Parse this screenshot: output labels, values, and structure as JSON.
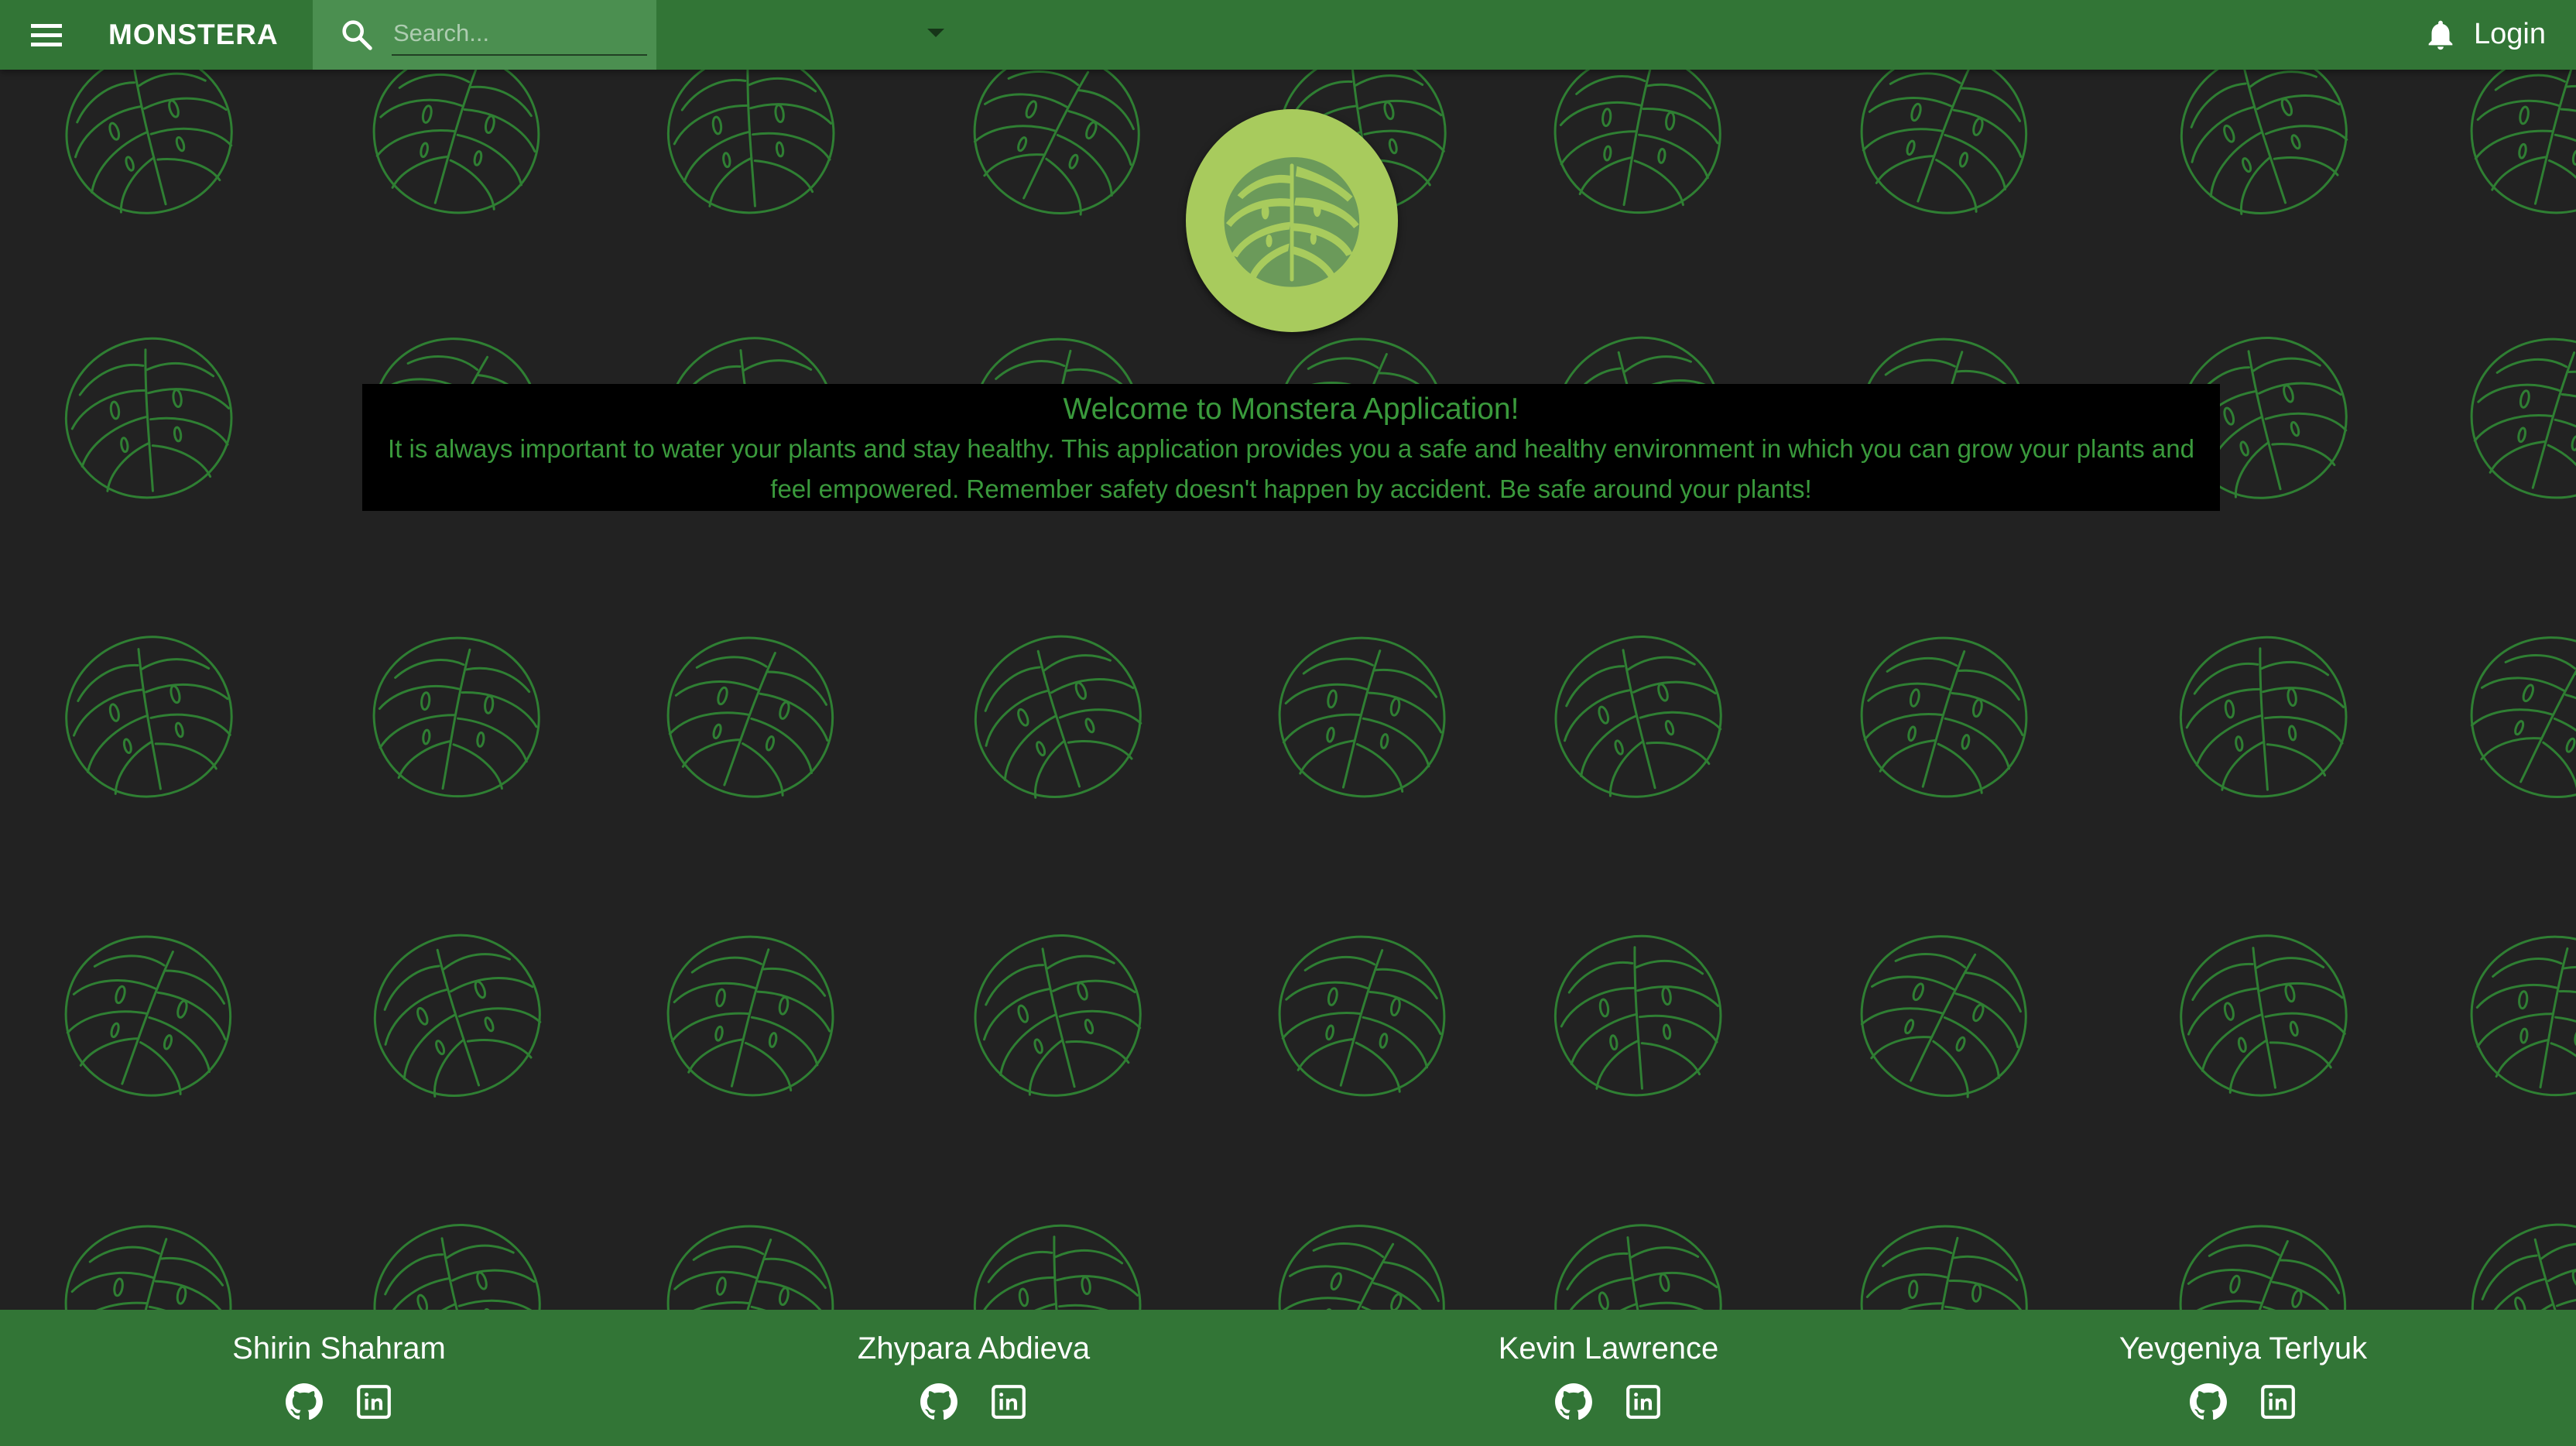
{
  "header": {
    "app_title": "MONSTERA",
    "search": {
      "placeholder": "Search..."
    },
    "login_label": "Login"
  },
  "welcome": {
    "title": "Welcome to Monstera Application!",
    "body": "It is always important to water your plants and stay healthy. This application provides you a safe and healthy environment in which you can grow your plants and feel empowered. Remember safety doesn't happen by accident. Be safe around your plants!"
  },
  "footer": {
    "members": [
      {
        "name": "Shirin Shahram"
      },
      {
        "name": "Zhypara Abdieva"
      },
      {
        "name": "Kevin Lawrence"
      },
      {
        "name": "Yevgeniya Terlyuk"
      }
    ]
  },
  "icons": {
    "menu": "menu-icon",
    "search": "search-icon",
    "dropdown": "dropdown-arrow-icon",
    "notifications": "bell-icon",
    "logo": "monstera-leaf-icon",
    "github": "github-icon",
    "linkedin": "linkedin-icon"
  },
  "colors": {
    "primary": "#327536",
    "search_bg": "#4b8f50",
    "background": "#222222",
    "leaf_pattern": "#2f7f33",
    "logo_circle": "#a8cb5d",
    "logo_leaf": "#6b9a5a",
    "welcome_panel": "#000000",
    "welcome_text": "#3a9a3c",
    "text_on_primary": "#ffffff"
  }
}
